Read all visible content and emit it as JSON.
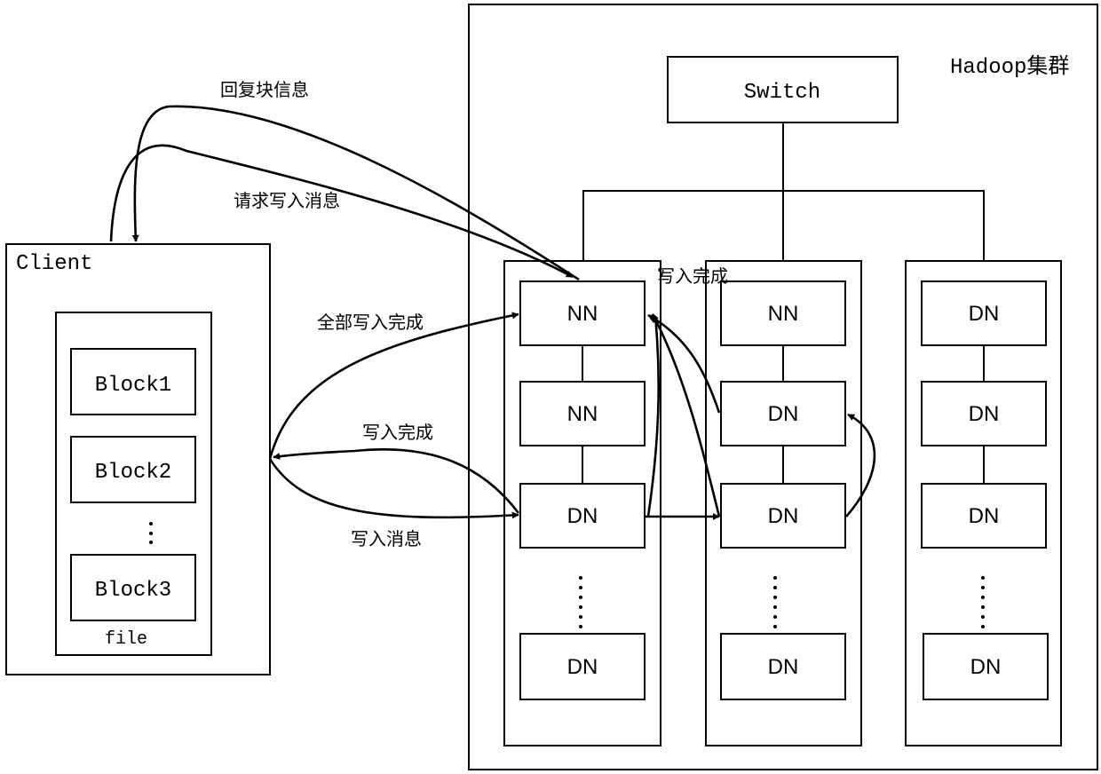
{
  "cluster": {
    "title": "Hadoop集群",
    "switch_label": "Switch",
    "racks": [
      {
        "nodes": [
          "NN",
          "NN",
          "DN",
          "DN"
        ]
      },
      {
        "nodes": [
          "NN",
          "DN",
          "DN",
          "DN"
        ]
      },
      {
        "nodes": [
          "DN",
          "DN",
          "DN",
          "DN"
        ]
      }
    ]
  },
  "client": {
    "title": "Client",
    "file_label": "file",
    "blocks": [
      "Block1",
      "Block2",
      "Block3"
    ]
  },
  "edge_labels": {
    "reply_block_info": "回复块信息",
    "request_write": "请求写入消息",
    "all_write_complete": "全部写入完成",
    "write_complete": "写入完成",
    "write_message": "写入消息",
    "write_complete_top": "写入完成"
  }
}
